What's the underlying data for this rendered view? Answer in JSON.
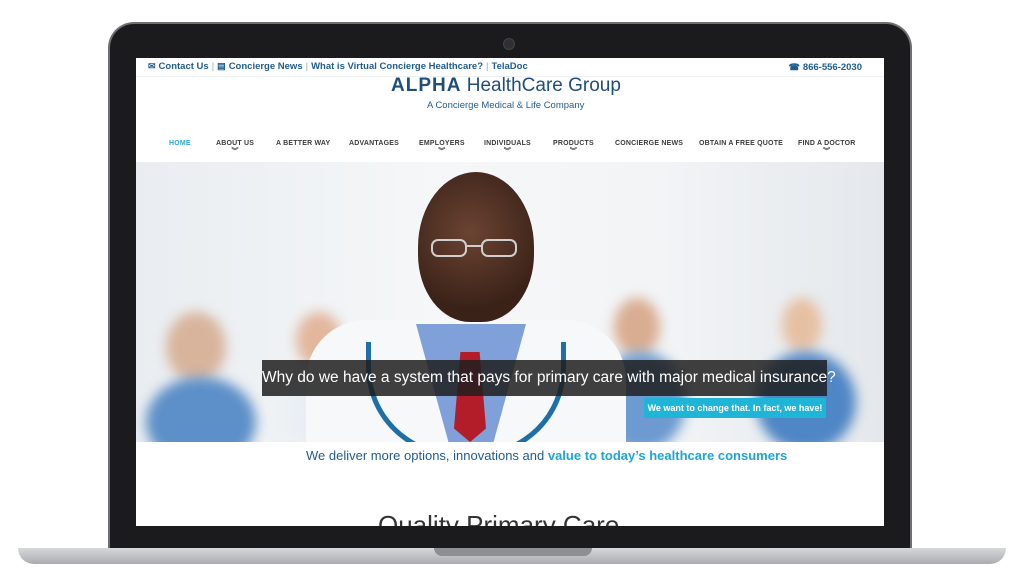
{
  "top_bar": {
    "links": [
      "Contact Us",
      "Concierge News",
      "What is Virtual Concierge Healthcare?",
      "TelaDoc"
    ],
    "phone": "866-556-2030"
  },
  "logo": {
    "brand": "ALPHA",
    "name": "HealthCare  Group",
    "tagline": "A Concierge Medical & Life Company"
  },
  "nav": {
    "items": [
      {
        "label": "HOME",
        "dropdown": false,
        "active": true
      },
      {
        "label": "ABOUT US",
        "dropdown": true
      },
      {
        "label": "A BETTER WAY",
        "dropdown": false
      },
      {
        "label": "ADVANTAGES",
        "dropdown": false
      },
      {
        "label": "EMPLOYERS",
        "dropdown": true
      },
      {
        "label": "INDIVIDUALS",
        "dropdown": true
      },
      {
        "label": "PRODUCTS",
        "dropdown": true
      },
      {
        "label": "CONCIERGE NEWS",
        "dropdown": false
      },
      {
        "label": "OBTAIN A FREE QUOTE",
        "dropdown": false
      },
      {
        "label": "FIND A DOCTOR",
        "dropdown": true
      }
    ]
  },
  "hero": {
    "caption": "Why do we have a system that pays for primary care with major medical insurance?",
    "subcaption": "We want to change that. In fact, we have!"
  },
  "tagline": {
    "text": "We deliver more options, innovations and ",
    "highlight": "value to today’s healthcare consumers"
  },
  "section": {
    "title": "Quality Primary Care"
  },
  "colors": {
    "brand_blue": "#1f5d8f",
    "accent_cyan": "#1fb5d6",
    "nav_active": "#29a8d8"
  }
}
